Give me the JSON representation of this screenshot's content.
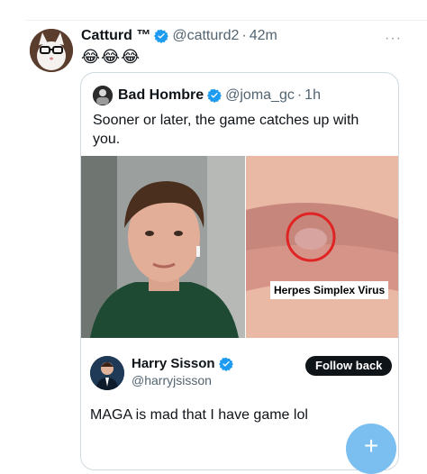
{
  "tweet": {
    "author_name": "Catturd ™",
    "author_handle": "@catturd2",
    "separator": "·",
    "time": "42m",
    "more_glyph": "···",
    "text": "😂😂😂"
  },
  "quoted": {
    "author_name": "Bad Hombre",
    "author_handle": "@joma_gc",
    "separator": "·",
    "time": "1h",
    "text": "Sooner or later, the game catches up with you.",
    "image_label": "Herpes Simplex Virus",
    "card": {
      "name": "Harry Sisson",
      "handle": "@harryjsisson",
      "follow_label": "Follow back",
      "text": "MAGA is mad that I have game lol"
    }
  },
  "fab_glyph": "+",
  "colors": {
    "verified": "#1d9bf0",
    "muted": "#536471",
    "border": "#cfd9de",
    "fab": "#7bbef0"
  }
}
